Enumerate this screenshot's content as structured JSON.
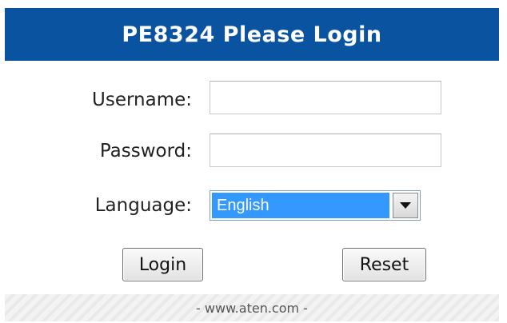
{
  "header": {
    "title": "PE8324 Please Login"
  },
  "form": {
    "username_label": "Username:",
    "username_value": "",
    "password_label": "Password:",
    "password_value": "",
    "language_label": "Language:",
    "language_selected": "English"
  },
  "buttons": {
    "login_label": "Login",
    "reset_label": "Reset"
  },
  "footer": {
    "text": "- www.aten.com -"
  },
  "colors": {
    "header_bg": "#0a53a0",
    "select_highlight": "#3399ff"
  }
}
